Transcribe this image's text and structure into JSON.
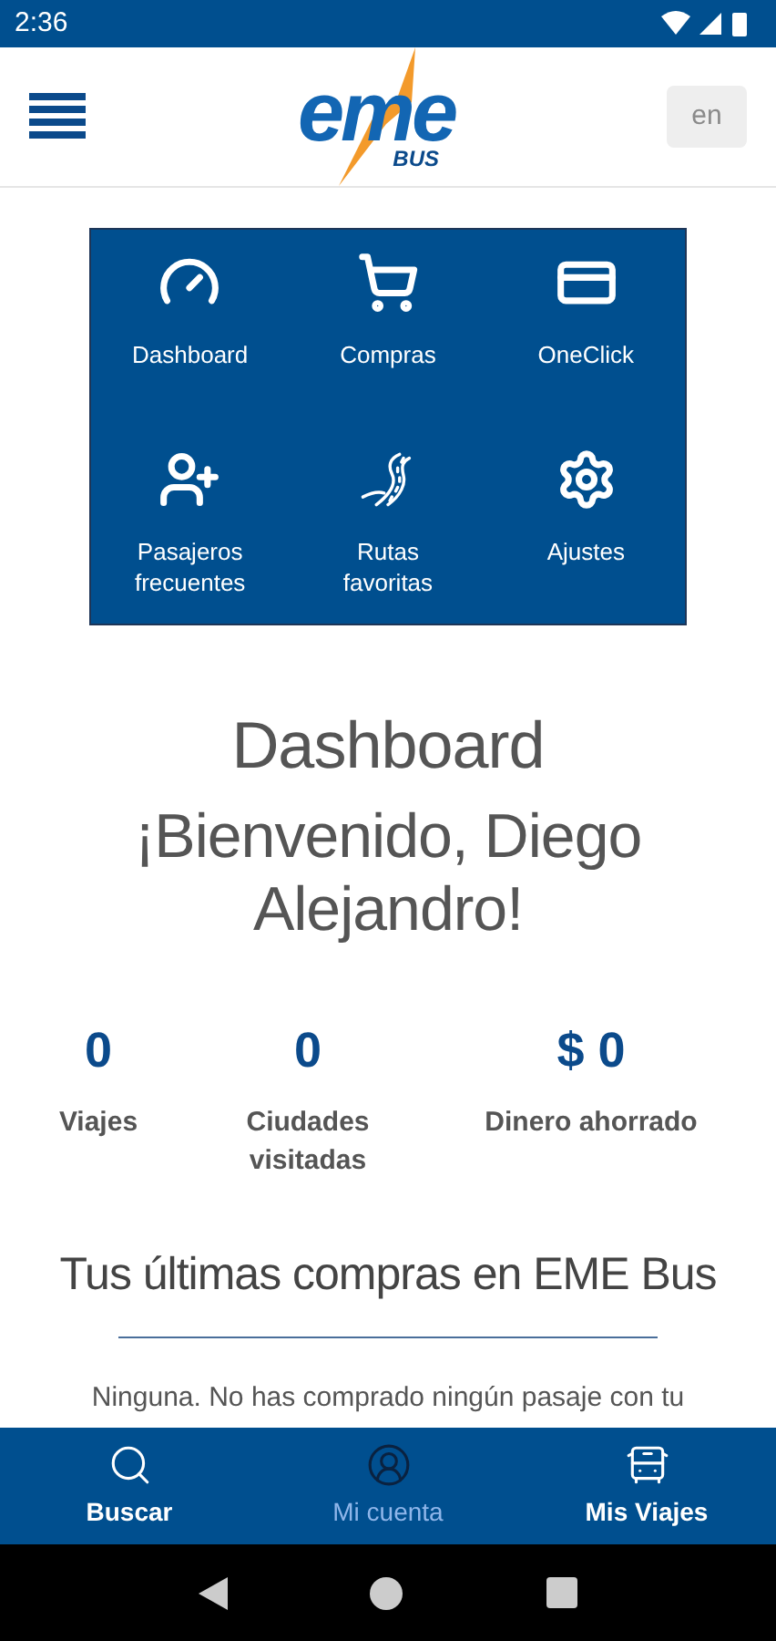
{
  "status_bar": {
    "time": "2:36"
  },
  "header": {
    "logo": {
      "word": "eme",
      "sub": "BUS"
    },
    "language_button": "en"
  },
  "menu_tiles": [
    {
      "label": "Dashboard"
    },
    {
      "label": "Compras"
    },
    {
      "label": "OneClick"
    },
    {
      "label": "Pasajeros frecuentes"
    },
    {
      "label": "Rutas favoritas"
    },
    {
      "label": "Ajustes"
    }
  ],
  "page_title": "Dashboard",
  "welcome": "¡Bienvenido, Diego Alejandro!",
  "stats": [
    {
      "value": "0",
      "label": "Viajes"
    },
    {
      "value": "0",
      "label": "Ciudades visitadas"
    },
    {
      "value": "$ 0",
      "label": "Dinero ahorrado"
    }
  ],
  "purchases": {
    "title": "Tus últimas compras en EME Bus",
    "message": "Ninguna. No has comprado ningún pasaje con tu"
  },
  "bottom_nav": [
    {
      "label": "Buscar",
      "selected": false
    },
    {
      "label": "Mi cuenta",
      "selected": true
    },
    {
      "label": "Mis Viajes",
      "selected": false
    }
  ]
}
